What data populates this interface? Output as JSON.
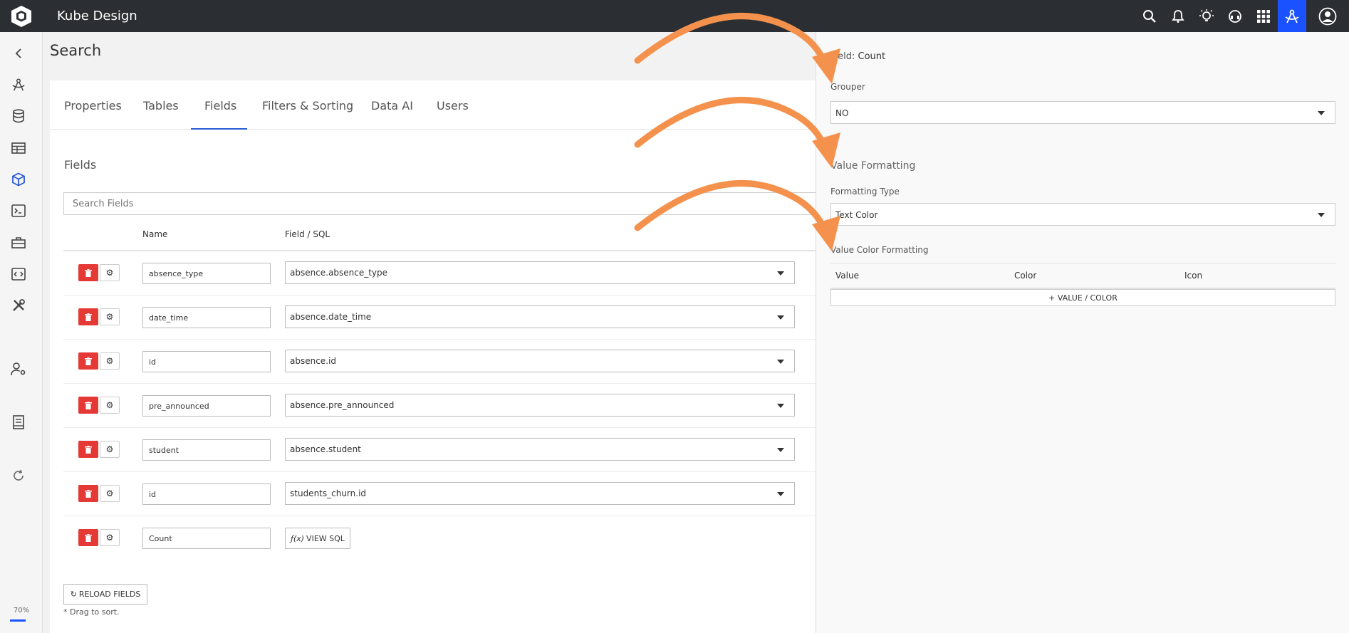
{
  "app": {
    "title": "Kube Design"
  },
  "topbar": {
    "icons": [
      "search-icon",
      "bell-icon",
      "lightbulb-icon",
      "headset-icon",
      "apps-grid-icon",
      "designer-compass-icon",
      "user-avatar-icon"
    ]
  },
  "sidebar": {
    "icons": [
      "back-arrow-icon",
      "designer-compass-icon",
      "database-icon",
      "table-icon",
      "cube-icon",
      "terminal-icon",
      "toolbox-icon",
      "code-icon",
      "tools-icon",
      "user-settings-icon",
      "book-icon",
      "refresh-icon"
    ],
    "zoom": "70%"
  },
  "page": {
    "title": "Search"
  },
  "tabs": [
    {
      "label": "Properties"
    },
    {
      "label": "Tables"
    },
    {
      "label": "Fields"
    },
    {
      "label": "Filters & Sorting"
    },
    {
      "label": "Data AI"
    },
    {
      "label": "Users"
    }
  ],
  "active_tab": "Fields",
  "fields_section": {
    "heading": "Fields",
    "search_placeholder": "Search Fields",
    "columns": {
      "name": "Name",
      "field_sql": "Field / SQL"
    },
    "rows": [
      {
        "name": "absence_type",
        "field": "absence.absence_type"
      },
      {
        "name": "date_time",
        "field": "absence.date_time"
      },
      {
        "name": "id",
        "field": "absence.id"
      },
      {
        "name": "pre_announced",
        "field": "absence.pre_announced"
      },
      {
        "name": "student",
        "field": "absence.student"
      },
      {
        "name": "id",
        "field": "students_churn.id"
      },
      {
        "name": "Count",
        "view_sql_label": "VIEW SQL"
      }
    ],
    "reload_label": "RELOAD FIELDS",
    "drag_note": "* Drag to sort."
  },
  "panel": {
    "field_prefix": "Field:",
    "field_name": "Count",
    "grouper_label": "Grouper",
    "grouper_value": "NO",
    "value_formatting_title": "Value Formatting",
    "formatting_type_label": "Formatting Type",
    "formatting_type_value": "Text Color",
    "value_color_title": "Value Color Formatting",
    "columns": {
      "value": "Value",
      "color": "Color",
      "icon": "Icon"
    },
    "add_label": "+ VALUE / COLOR"
  },
  "colors": {
    "topbar": "#2b2f33",
    "accent": "#1a52ff",
    "delete": "#e53935",
    "annotation_arrow": "#f4924d"
  }
}
